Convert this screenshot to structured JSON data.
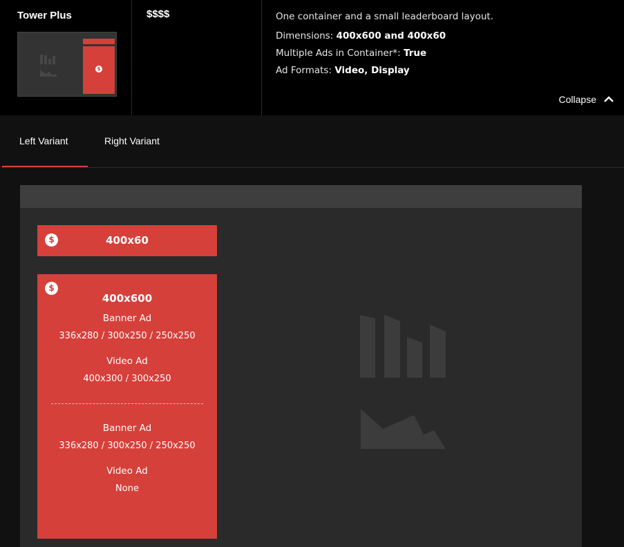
{
  "product": {
    "name": "Tower Plus",
    "price": "$$$$",
    "description": "One container and a small leaderboard layout.",
    "dimensions_label": "Dimensions:",
    "dimensions_value": "400x600 and 400x60",
    "multiple_ads_label": "Multiple Ads in Container*:",
    "multiple_ads_value": "True",
    "ad_formats_label": "Ad Formats:",
    "ad_formats_value": "Video, Display",
    "collapse_label": "Collapse",
    "thumbnail_coin": "$"
  },
  "tabs": [
    {
      "label": "Left Variant",
      "active": true
    },
    {
      "label": "Right Variant",
      "active": false
    }
  ],
  "preview": {
    "leaderboard": {
      "title": "400x60",
      "coin": "$"
    },
    "tower": {
      "coin": "$",
      "title": "400x600",
      "top": {
        "banner_label": "Banner Ad",
        "banner_sizes": "336x280 / 300x250 / 250x250",
        "video_label": "Video Ad",
        "video_sizes": "400x300 / 300x250"
      },
      "bottom": {
        "banner_label": "Banner Ad",
        "banner_sizes": "336x280 / 300x250 / 250x250",
        "video_label": "Video Ad",
        "video_sizes": "None"
      }
    }
  },
  "colors": {
    "accent": "#d6403a",
    "background": "#111111",
    "header": "#000000",
    "preview_bg": "#2a2a2a",
    "placeholder_icon": "#3c3c3c"
  },
  "icons": {
    "collapse": "chevron-up-icon",
    "coin": "dollar-coin-icon",
    "placeholder": "bar-chart-icon"
  }
}
